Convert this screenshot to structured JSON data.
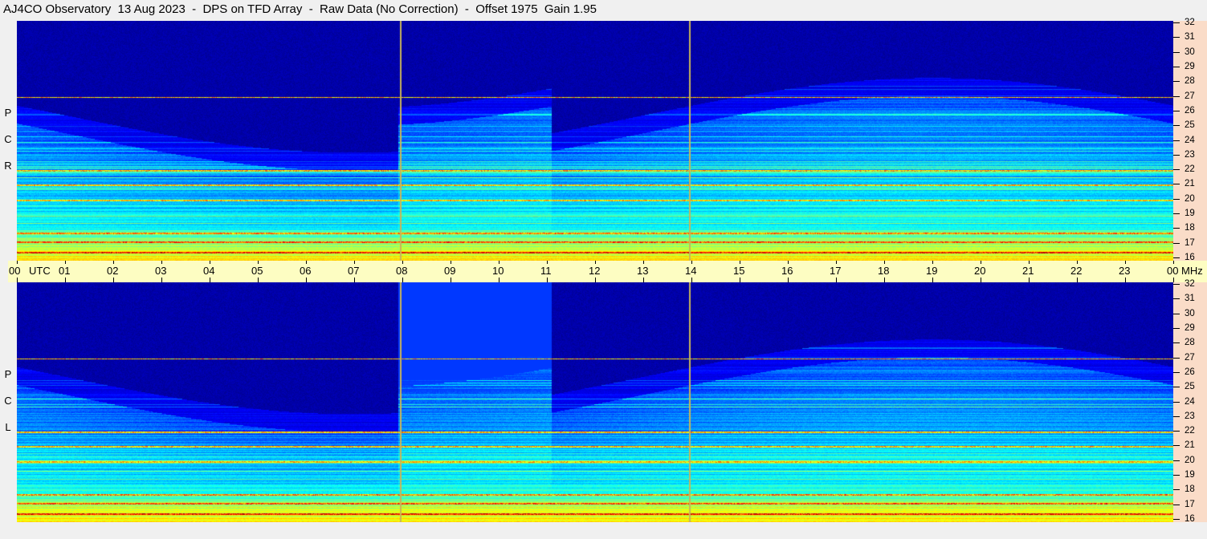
{
  "title": "AJ4CO Observatory  13 Aug 2023  -  DPS on TFD Array  -  Raw Data (No Correction)  -  Offset 1975  Gain 1.95",
  "panels": [
    {
      "letters": [
        "R",
        "C",
        "P"
      ]
    },
    {
      "letters": [
        "L",
        "C",
        "P"
      ]
    }
  ],
  "time_axis": {
    "unit_label": "UTC",
    "labels": [
      "00",
      "01",
      "02",
      "03",
      "04",
      "05",
      "06",
      "07",
      "08",
      "09",
      "10",
      "11",
      "12",
      "13",
      "14",
      "15",
      "16",
      "17",
      "18",
      "19",
      "20",
      "21",
      "22",
      "23",
      "00"
    ],
    "end_unit": "MHz"
  },
  "freq_axis": {
    "labels": [
      "16",
      "17",
      "18",
      "19",
      "20",
      "21",
      "22",
      "23",
      "24",
      "25",
      "26",
      "27",
      "28",
      "29",
      "30",
      "31",
      "32"
    ]
  },
  "colors": {
    "page_bg": "#f0f0f0",
    "time_axis_bg": "#fdfdc2",
    "freq_axis_bg": "#fadcc8",
    "marker_line": "#c8b45a"
  },
  "chart_data": {
    "type": "heatmap",
    "title": "AJ4CO Observatory  13 Aug 2023  -  DPS on TFD Array  -  Raw Data (No Correction)  -  Offset 1975  Gain 1.95",
    "x_axis": {
      "label": "UTC",
      "range": [
        0,
        24
      ],
      "unit": "hour"
    },
    "y_axis": {
      "label": "MHz",
      "range": [
        16,
        32
      ]
    },
    "panels": [
      "RCP",
      "LCP"
    ],
    "vertical_markers_utc": [
      7.95,
      13.95
    ],
    "strong_emission_bands_mhz": [
      16.5,
      17.2,
      17.8,
      20.0,
      21.0,
      22.0,
      26.9
    ],
    "colormap": "jet"
  }
}
